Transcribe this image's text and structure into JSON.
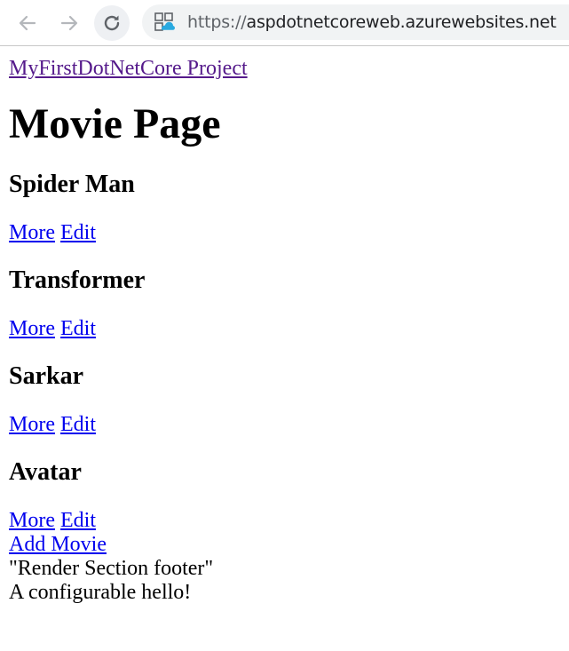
{
  "browser": {
    "url_scheme": "https://",
    "url_host": "aspdotnetcoreweb.azurewebsites.net"
  },
  "header": {
    "site_link": "MyFirstDotNetCore Project"
  },
  "page": {
    "title": "Movie Page"
  },
  "movies": [
    {
      "title": "Spider Man",
      "more_label": "More",
      "edit_label": "Edit"
    },
    {
      "title": "Transformer",
      "more_label": "More",
      "edit_label": "Edit"
    },
    {
      "title": "Sarkar",
      "more_label": "More",
      "edit_label": "Edit"
    },
    {
      "title": "Avatar",
      "more_label": "More",
      "edit_label": "Edit"
    }
  ],
  "footer": {
    "add_movie": "Add Movie",
    "render_section": "\"Render Section footer\"",
    "greeting": "A configurable hello!"
  },
  "colors": {
    "link": "#0000ee",
    "visited_link": "#551a8b",
    "toolbar_icon": "#5f6368",
    "site_icon_accent": "#29a9e0"
  },
  "icons": {
    "back": "back-arrow-icon",
    "forward": "forward-arrow-icon",
    "reload": "reload-icon",
    "site": "site-cloud-icon"
  }
}
